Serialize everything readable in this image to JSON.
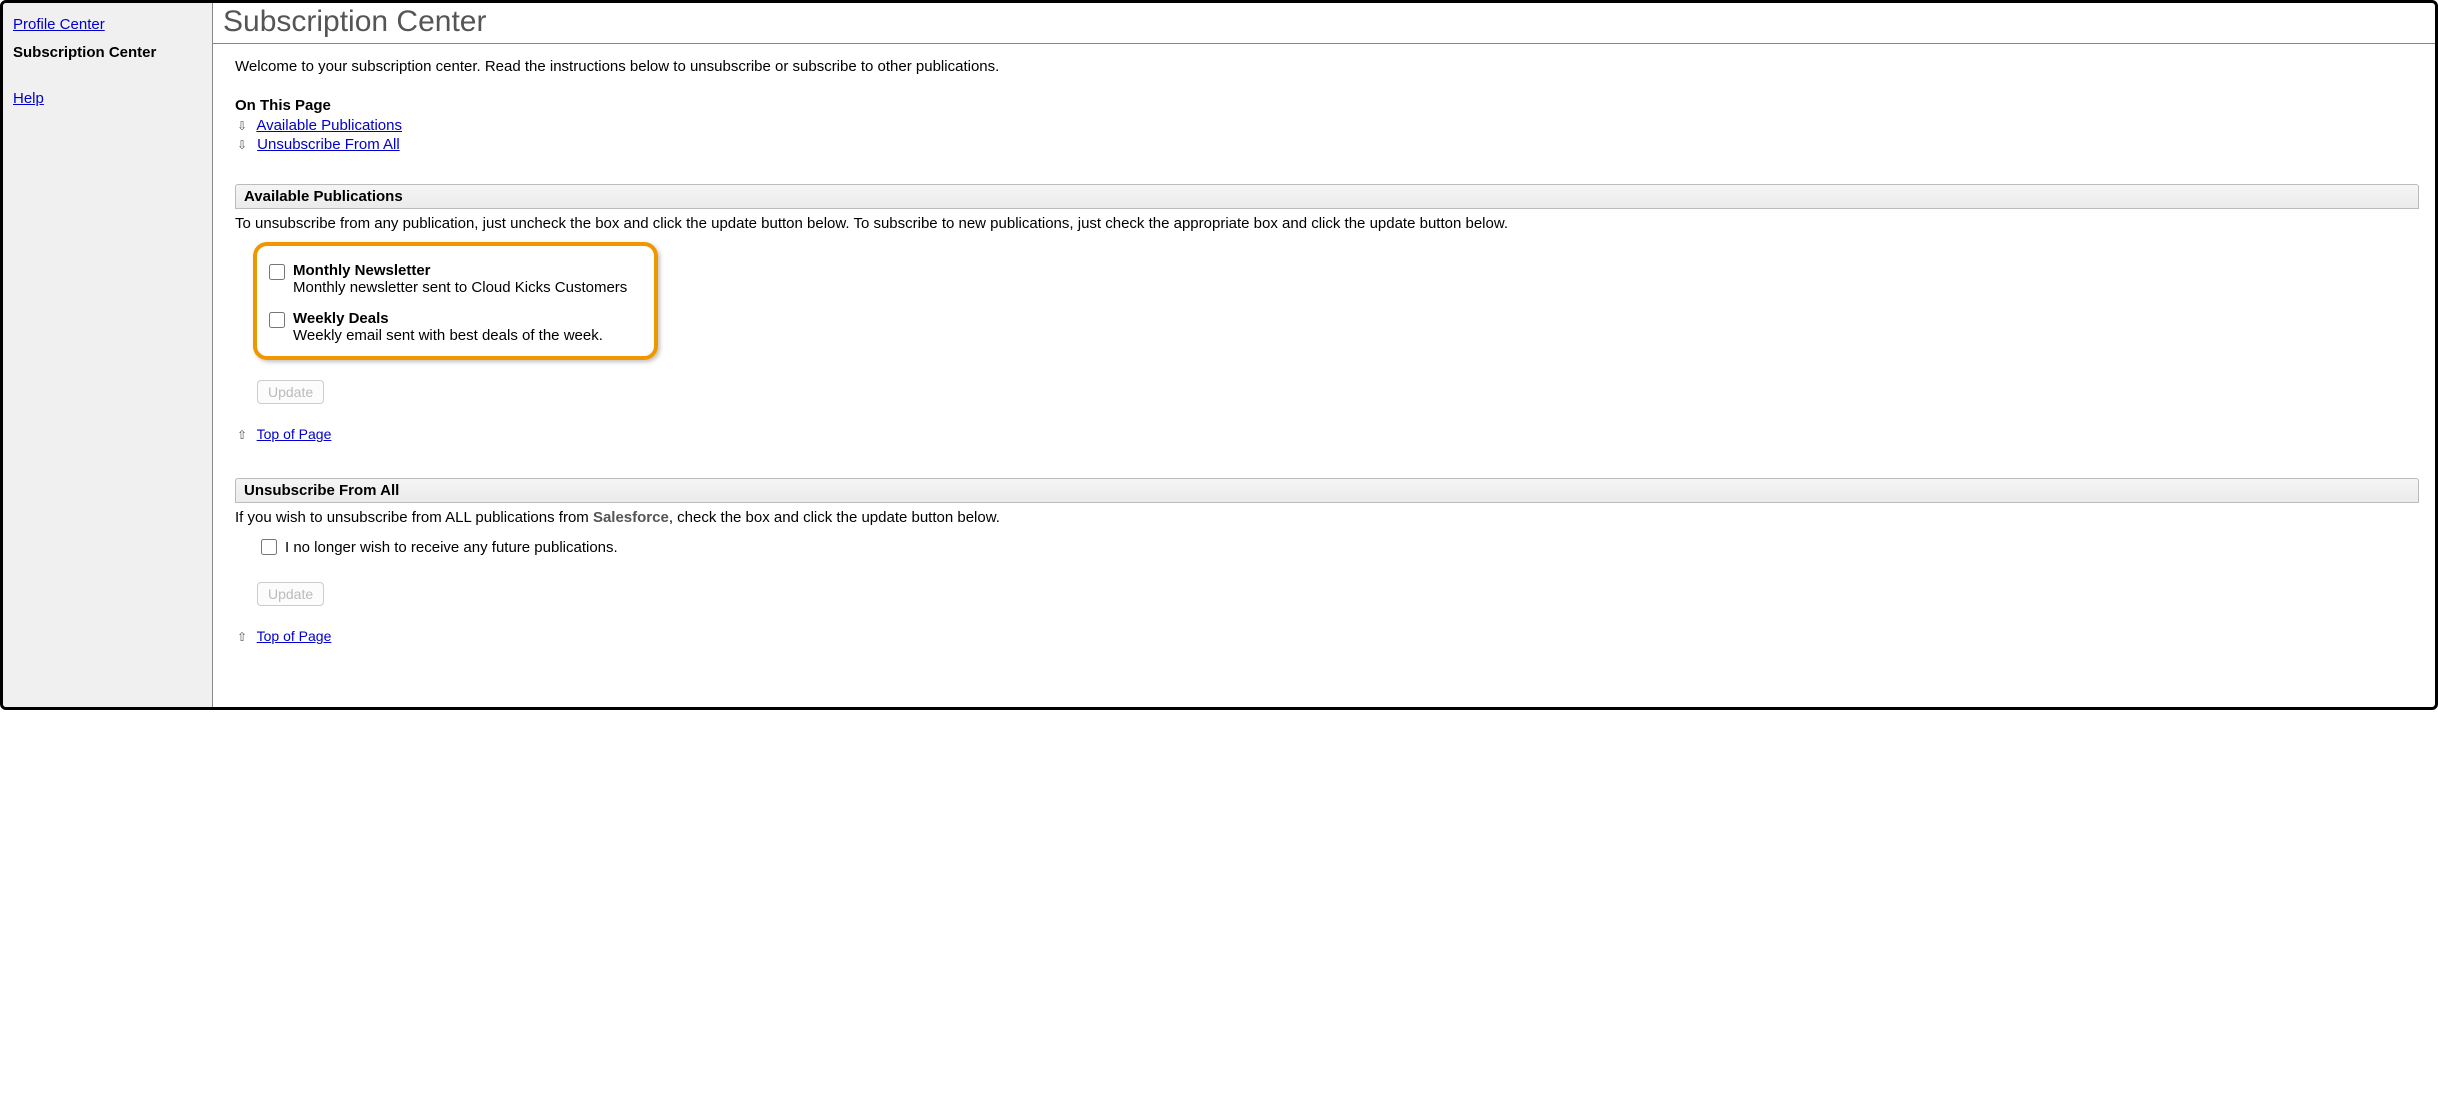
{
  "sidebar": {
    "profile_center": "Profile Center",
    "subscription_center": "Subscription Center",
    "help": "Help"
  },
  "page": {
    "title": "Subscription Center",
    "welcome": "Welcome to your subscription center. Read the instructions below to unsubscribe or subscribe to other publications."
  },
  "otp": {
    "heading": "On This Page",
    "available_link": "Available Publications",
    "unsubscribe_link": "Unsubscribe From All"
  },
  "available": {
    "header": "Available Publications",
    "instruction": "To unsubscribe from any publication, just uncheck the box and click the update button below. To subscribe to new publications, just check the appropriate box and click the update button below.",
    "publications": [
      {
        "title": "Monthly Newsletter",
        "desc": "Monthly newsletter sent to Cloud Kicks Customers"
      },
      {
        "title": "Weekly Deals",
        "desc": "Weekly email sent with best deals of the week."
      }
    ],
    "update_button": "Update",
    "top_link": "Top of Page"
  },
  "unsubscribe": {
    "header": "Unsubscribe From All",
    "instruction_prefix": "If you wish to unsubscribe from ALL publications from ",
    "sender": "Salesforce",
    "instruction_suffix": ", check the box and click the update button below.",
    "checkbox_label": "I no longer wish to receive any future publications.",
    "update_button": "Update",
    "top_link": "Top of Page"
  }
}
